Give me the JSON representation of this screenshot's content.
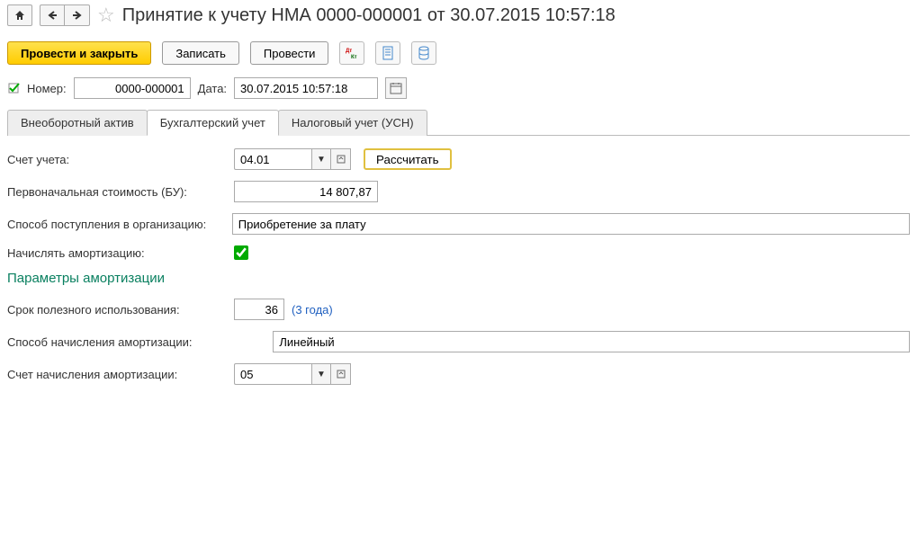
{
  "header": {
    "title": "Принятие к учету НМА 0000-000001 от 30.07.2015 10:57:18"
  },
  "toolbar": {
    "post_close": "Провести и закрыть",
    "save": "Записать",
    "post": "Провести"
  },
  "form": {
    "number_label": "Номер:",
    "number_value": "0000-000001",
    "date_label": "Дата:",
    "date_value": "30.07.2015 10:57:18"
  },
  "tabs": {
    "t1": "Внеоборотный актив",
    "t2": "Бухгалтерский учет",
    "t3": "Налоговый учет (УСН)"
  },
  "fields": {
    "account_label": "Счет учета:",
    "account_value": "04.01",
    "calc_btn": "Рассчитать",
    "cost_label": "Первоначальная стоимость (БУ):",
    "cost_value": "14 807,87",
    "method_label": "Способ поступления в организацию:",
    "method_value": "Приобретение за плату",
    "amort_label": "Начислять амортизацию:",
    "section_title": "Параметры амортизации",
    "life_label": "Срок полезного использования:",
    "life_value": "36",
    "life_hint": "(3 года)",
    "amort_method_label": "Способ начисления амортизации:",
    "amort_method_value": "Линейный",
    "amort_account_label": "Счет начисления амортизации:",
    "amort_account_value": "05"
  }
}
